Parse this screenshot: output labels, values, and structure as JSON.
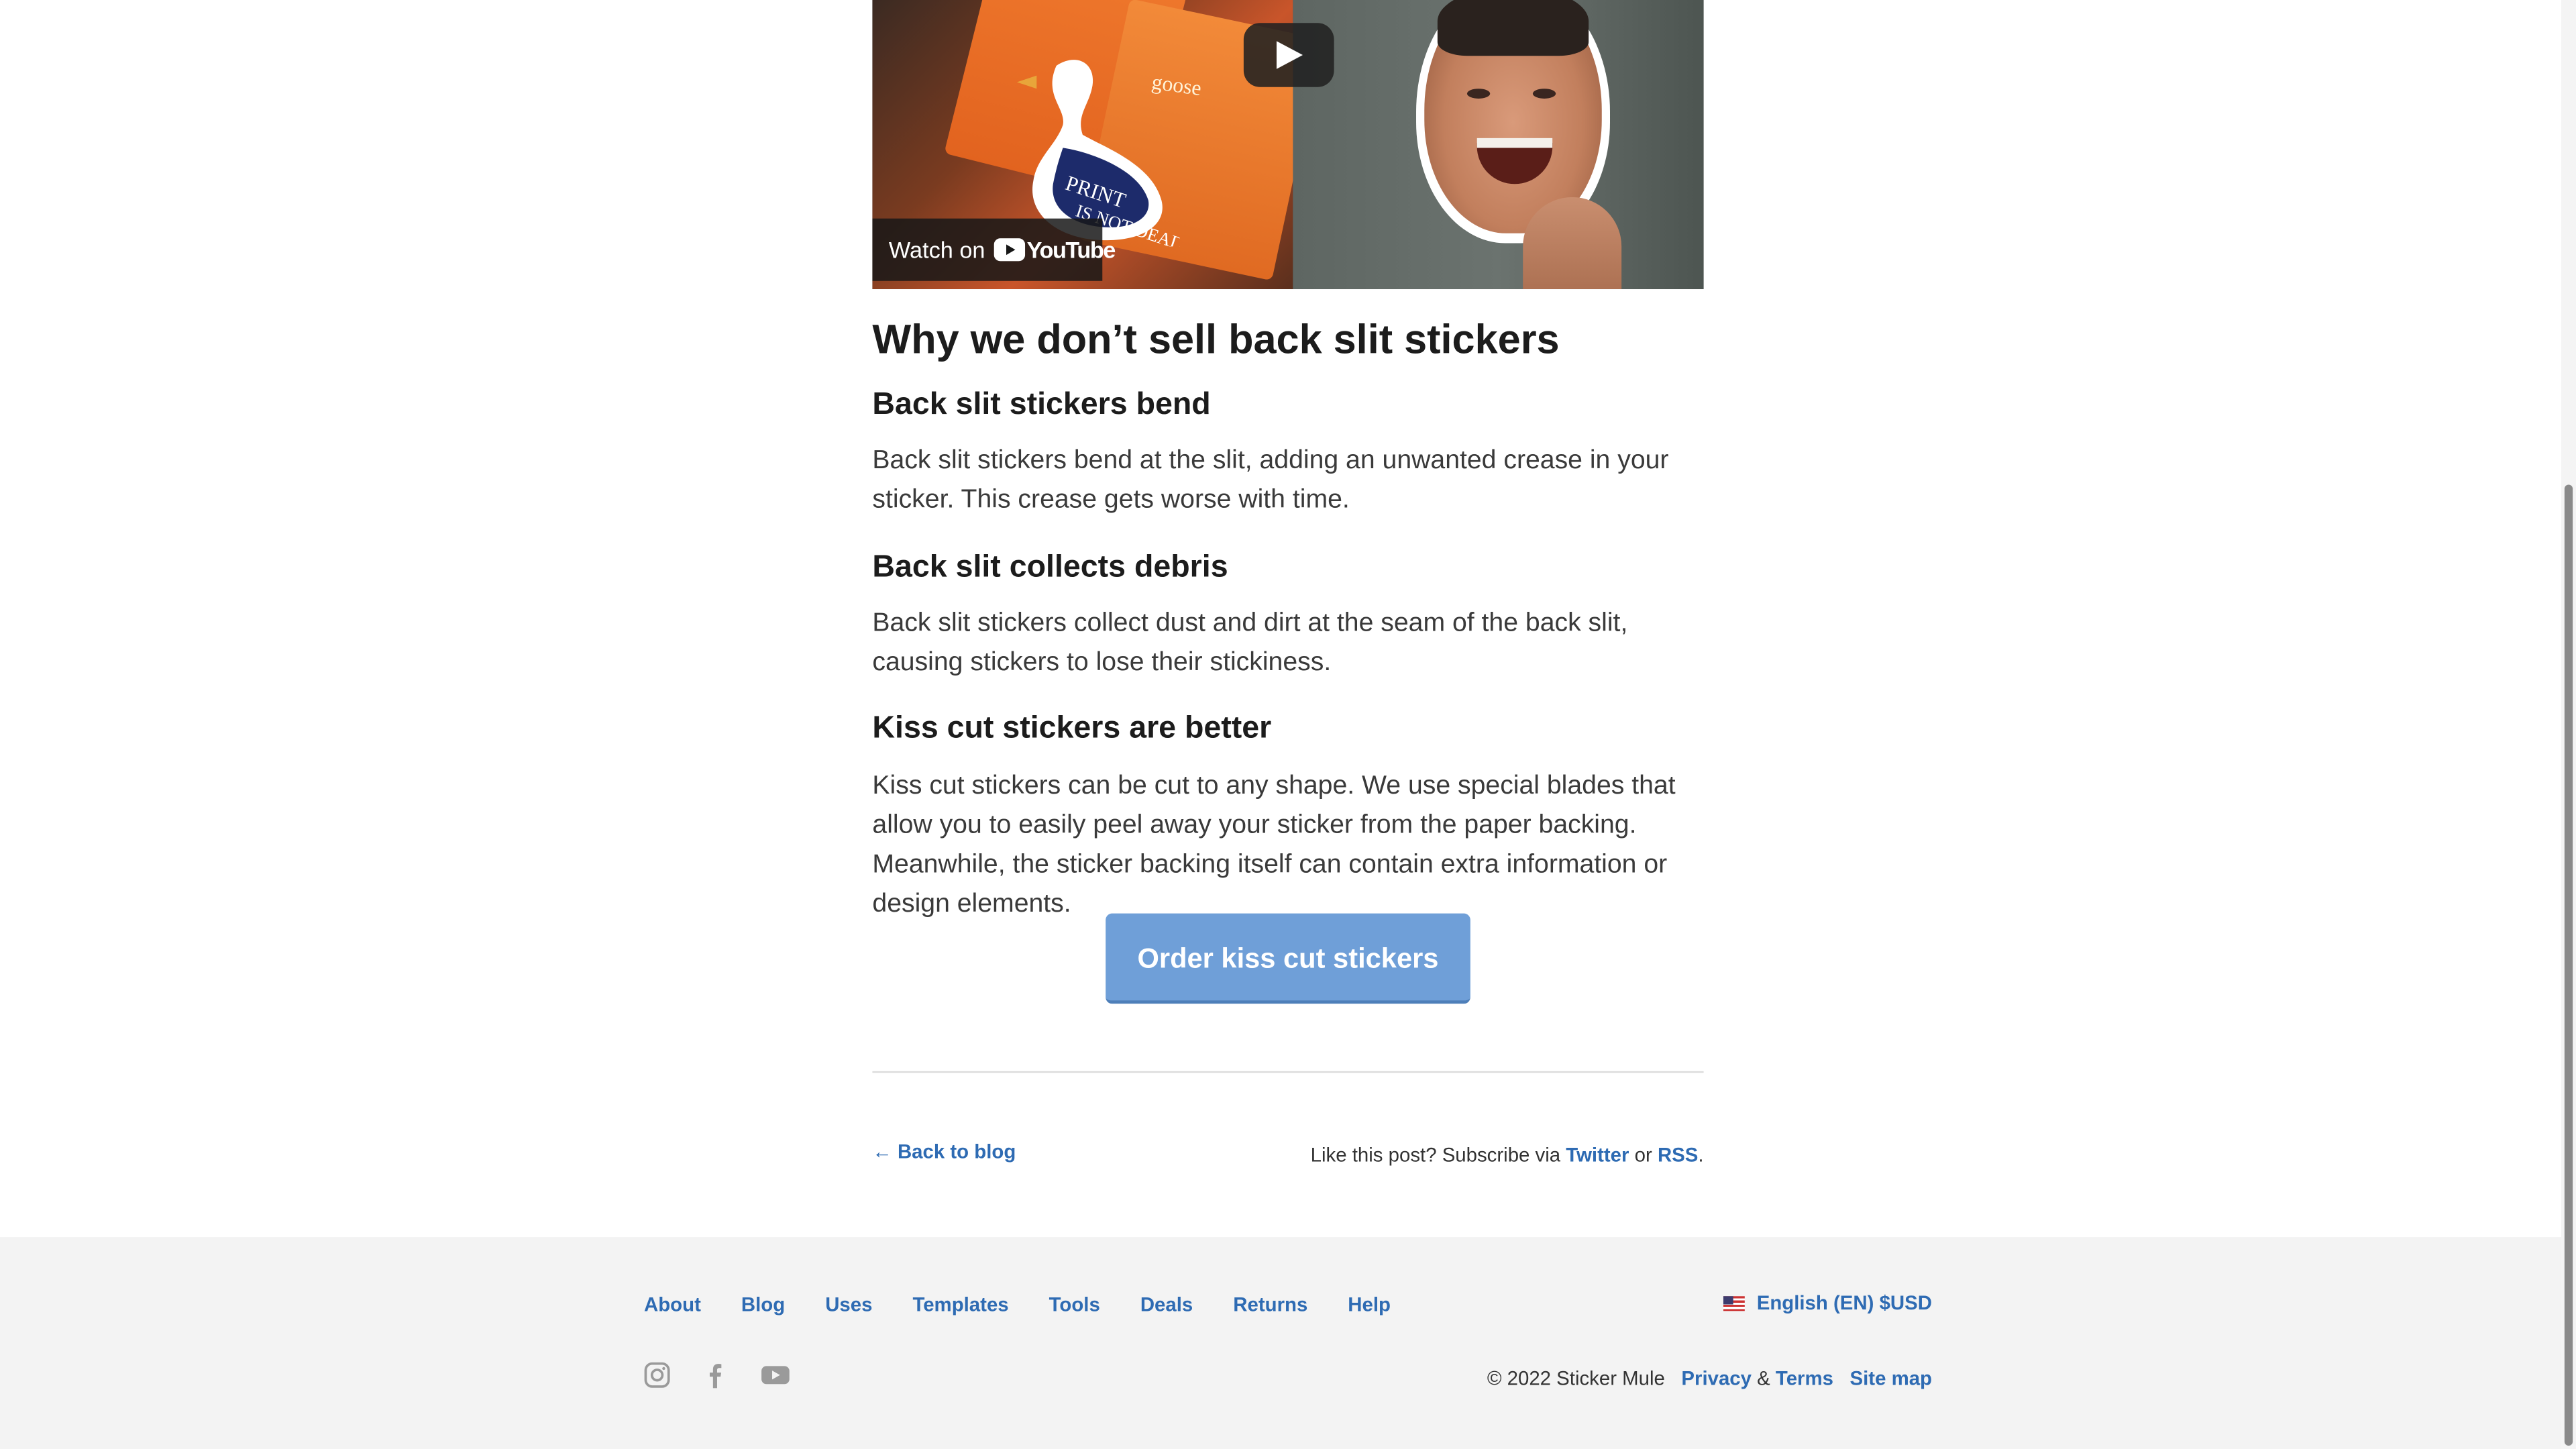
{
  "video": {
    "watch_label": "Watch on",
    "youtube_wordmark": "YouTube"
  },
  "article": {
    "heading": "Why we don’t sell back slit stickers",
    "sections": [
      {
        "title": "Back slit stickers bend",
        "body": "Back slit stickers bend at the slit, adding an unwanted crease in your sticker. This crease gets worse with time."
      },
      {
        "title": "Back slit collects debris",
        "body": "Back slit stickers collect dust and dirt at the seam of the back slit, causing stickers to lose their stickiness."
      },
      {
        "title": "Kiss cut stickers are better",
        "body": "Kiss cut stickers can be cut to any shape. We use special blades that allow you to easily peel away your sticker from the paper backing. Meanwhile, the sticker backing itself can contain extra information or design elements."
      }
    ],
    "cta_label": "Order kiss cut stickers",
    "back_link": "← Back to blog",
    "subscribe": {
      "prefix": "Like this post? Subscribe via ",
      "twitter": "Twitter",
      "or": " or ",
      "rss": "RSS",
      "suffix": "."
    }
  },
  "footer": {
    "nav": [
      "About",
      "Blog",
      "Uses",
      "Templates",
      "Tools",
      "Deals",
      "Returns",
      "Help"
    ],
    "language": "English (EN) $USD",
    "social_icons": [
      "instagram-icon",
      "facebook-icon",
      "youtube-icon"
    ],
    "copyright": "© 2022 Sticker Mule",
    "privacy": "Privacy",
    "amp": " & ",
    "terms": "Terms",
    "sitemap": "Site map"
  },
  "colors": {
    "link": "#2e6bb3",
    "cta": "#6f9fd8",
    "footer_bg": "#f3f3f3"
  }
}
